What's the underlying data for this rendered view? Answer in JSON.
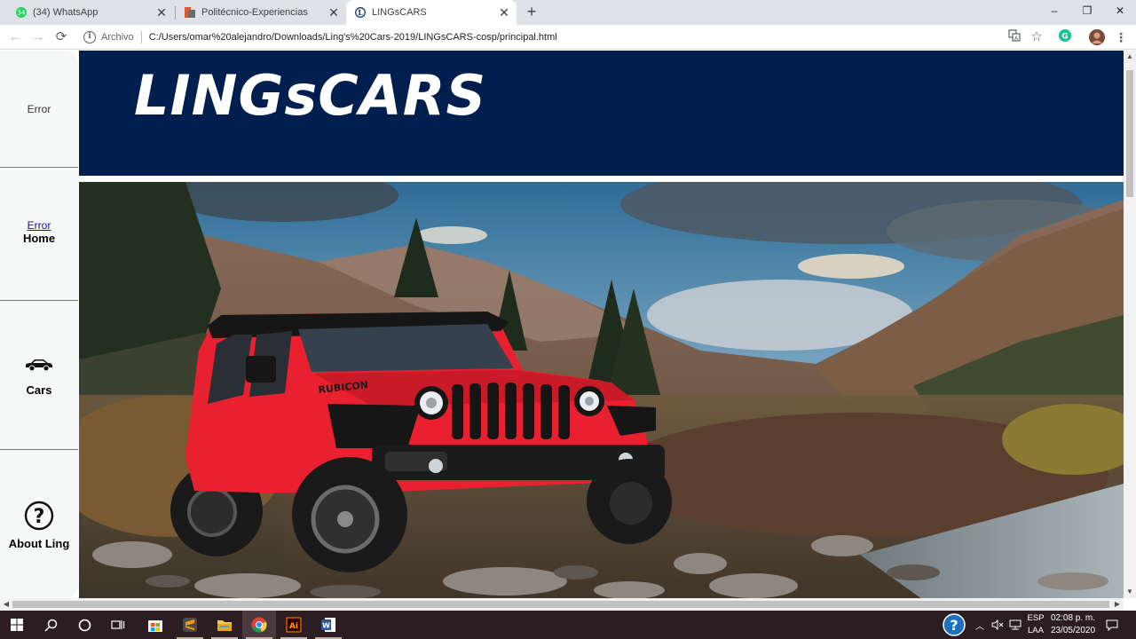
{
  "browser": {
    "tabs": [
      {
        "title": "(34) WhatsApp",
        "icon": "whatsapp-icon",
        "active": false
      },
      {
        "title": "Politécnico-Experiencias",
        "icon": "politecnico-icon",
        "active": false
      },
      {
        "title": "LINGsCARS",
        "icon": "page-logo-icon",
        "active": true
      }
    ],
    "new_tab_label": "+",
    "address": {
      "scheme_label": "Archivo",
      "url": "C:/Users/omar%20alejandro/Downloads/Ling's%20Cars-2019/LINGsCARS-cosp/principal.html"
    }
  },
  "page": {
    "sidebar": {
      "logo_alt": "Error",
      "home_alt": "Error",
      "home_label": "Home",
      "cars_label": "Cars",
      "about_label": "About Ling"
    },
    "banner": {
      "logo_text_a": "LINGs",
      "logo_text_b": "CARS"
    },
    "hero": {
      "subject": "red Jeep Wrangler Rubicon in mountain valley",
      "badge_text": "RUBICON"
    }
  },
  "taskbar": {
    "apps": [
      "start",
      "search",
      "cortana",
      "task-view",
      "store",
      "sublime",
      "file-explorer",
      "chrome",
      "illustrator",
      "word"
    ],
    "tray": {
      "lang_line1": "ESP",
      "lang_line2": "LAA",
      "time": "02:08 p. m.",
      "date": "23/05/2020"
    }
  },
  "colors": {
    "banner": "#001e4e",
    "tabstrip": "#dee1e6",
    "taskbar": "#2b1d22",
    "jeep": "#e8202f"
  }
}
